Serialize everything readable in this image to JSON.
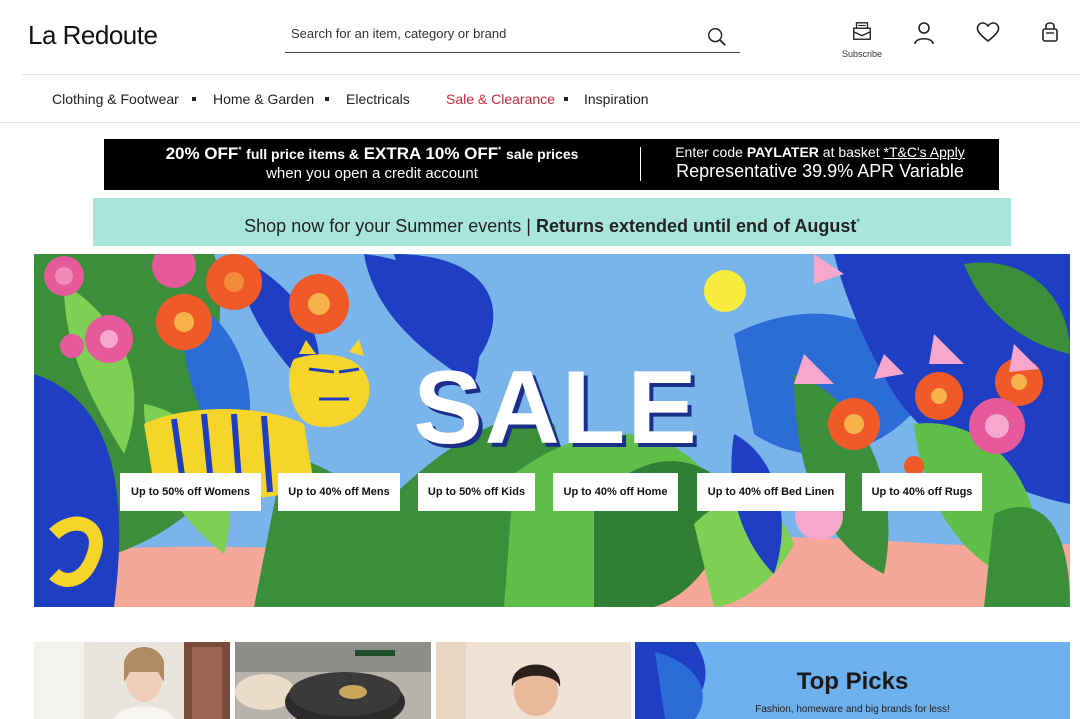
{
  "header": {
    "logo": "La Redoute",
    "search_placeholder": "Search for an item, category or brand",
    "subscribe_label": "Subscribe"
  },
  "nav": {
    "items": [
      {
        "label": "Clothing & Footwear"
      },
      {
        "label": "Home & Garden"
      },
      {
        "label": "Electricals"
      },
      {
        "label": "Sale & Clearance"
      },
      {
        "label": "Inspiration"
      }
    ]
  },
  "promo": {
    "credit_pre": "20% OFF",
    "credit_mid": "full price items &",
    "credit_extra": "EXTRA 10% OFF",
    "credit_post": "sale prices",
    "credit_line2": "when you open a credit account",
    "code_pre": "Enter code",
    "code": "PAYLATER",
    "code_post": "at basket",
    "tc": "*T&C's Apply",
    "apr": "Representative 39.9% APR Variable",
    "summer_pre": "Shop now for your Summer events |",
    "summer_bold": "Returns extended until end of August",
    "star": "*"
  },
  "hero": {
    "title": "SALE",
    "buttons": [
      {
        "label": "Up to 50% off Womens"
      },
      {
        "label": "Up to 40% off Mens"
      },
      {
        "label": "Up to 50% off Kids"
      },
      {
        "label": "Up to 40% off Home"
      },
      {
        "label": "Up to 40% off Bed Linen"
      },
      {
        "label": "Up to 40% off Rugs"
      }
    ]
  },
  "tiles": {
    "top_picks_title": "Top Picks",
    "top_picks_sub": "Fashion, homeware and big brands for less!"
  },
  "colors": {
    "sale_red": "#d2243a",
    "mint": "#a8e6dc",
    "hero_sky": "#79b5ea"
  }
}
